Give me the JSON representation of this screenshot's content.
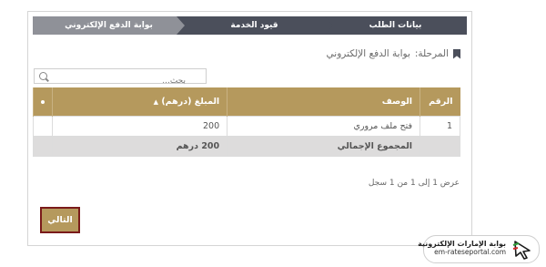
{
  "wizard": {
    "steps": [
      {
        "label": "بيانات الطلب"
      },
      {
        "label": "قيود الخدمة"
      },
      {
        "label": "بوابة الدفع الإلكتروني"
      }
    ]
  },
  "stage": {
    "label": "المرحلة:",
    "value": "بوابة الدفع الإلكتروني"
  },
  "search": {
    "placeholder": "بحث..."
  },
  "table": {
    "headers": {
      "number": "الرقم",
      "description": "الوصف",
      "amount": "المبلغ (درهم)"
    },
    "rows": [
      {
        "number": "1",
        "description": "فتح ملف مروري",
        "amount": "200"
      }
    ],
    "total": {
      "label": "المجموع الإجمالي",
      "value": "200 درهم"
    }
  },
  "info": "عرض 1 إلى 1 من 1 سجل",
  "next_button": "التالي",
  "watermark": {
    "arabic": "بوابة الإمارات الإلكترونية",
    "english": "em-rateseportal.com"
  },
  "colors": {
    "header": "#b5995d",
    "step_dark": "#4b4f5b",
    "step_active": "#8f9198",
    "button_border": "#7a1a1a"
  }
}
